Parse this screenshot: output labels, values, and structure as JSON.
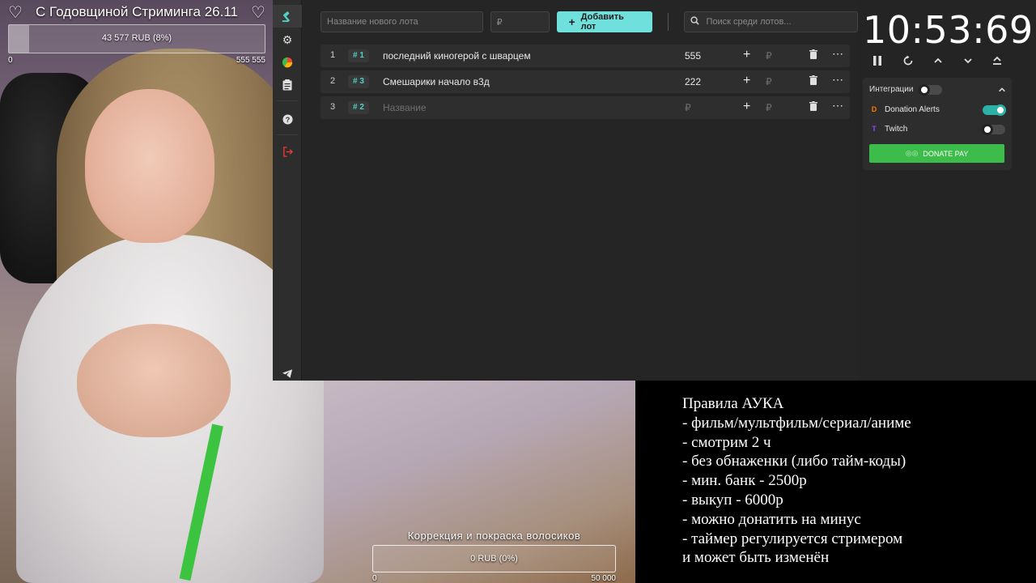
{
  "goal_top": {
    "title": "С Годовщиной Стриминга 26.11",
    "progress_label": "43 577 RUB (8%)",
    "progress_fraction": 0.08,
    "min": "0",
    "max": "555 555"
  },
  "goal_bottom": {
    "title": "Коррекция и покраска волосиков",
    "progress_label": "0 RUB (0%)",
    "progress_fraction": 0,
    "min": "0",
    "max": "50 000"
  },
  "sidebar": {
    "items": [
      {
        "name": "auction",
        "icon": "gavel-icon",
        "glyph": "🔨"
      },
      {
        "name": "settings",
        "icon": "gear-icon",
        "glyph": "⚙"
      },
      {
        "name": "stats",
        "icon": "pie-chart-icon",
        "glyph": "◕"
      },
      {
        "name": "history",
        "icon": "clipboard-icon",
        "glyph": "📋"
      },
      {
        "name": "help",
        "icon": "help-icon",
        "glyph": "?"
      },
      {
        "name": "logout",
        "icon": "logout-icon",
        "glyph": "⇥"
      },
      {
        "name": "telegram",
        "icon": "telegram-icon",
        "glyph": "➤"
      }
    ]
  },
  "toolbar": {
    "new_lot_placeholder": "Название нового лота",
    "amount_placeholder": "₽",
    "add_button": "Добавить лот",
    "search_placeholder": "Поиск среди лотов..."
  },
  "lots": [
    {
      "index": "1",
      "id": "1",
      "name": "последний киногерой с шварцем",
      "amount": "555",
      "placeholder_name": false,
      "placeholder_amount": false
    },
    {
      "index": "2",
      "id": "3",
      "name": "Смешарики начало в3д",
      "amount": "222",
      "placeholder_name": false,
      "placeholder_amount": false
    },
    {
      "index": "3",
      "id": "2",
      "name": "Название",
      "amount": "₽",
      "placeholder_name": true,
      "placeholder_amount": true
    }
  ],
  "lot_labels": {
    "rub": "₽",
    "plus": "+",
    "more": "⋯"
  },
  "timer": {
    "value": "10:53:69"
  },
  "integrations": {
    "header": "Интеграции",
    "header_enabled": false,
    "items": [
      {
        "name": "Donation Alerts",
        "enabled": true,
        "color": "#f57c00",
        "glyph": "D"
      },
      {
        "name": "Twitch",
        "enabled": false,
        "color": "#9146ff",
        "glyph": "T"
      }
    ],
    "donate_pay_label": "DONATE PAY"
  },
  "rules": {
    "lines": [
      "Правила АУКА",
      "- фильм/мультфильм/сериал/аниме",
      "- смотрим 2 ч",
      "- без обнаженки (либо тайм-коды)",
      "- мин. банк - 2500р",
      "- выкуп - 6000р",
      "- можно донатить на минус",
      "- таймер регулируется стримером",
      "и может быть изменён"
    ]
  },
  "colors": {
    "accent": "#6fe0dc",
    "teal": "#4fd1c5",
    "donate_green": "#3cbc4a"
  }
}
